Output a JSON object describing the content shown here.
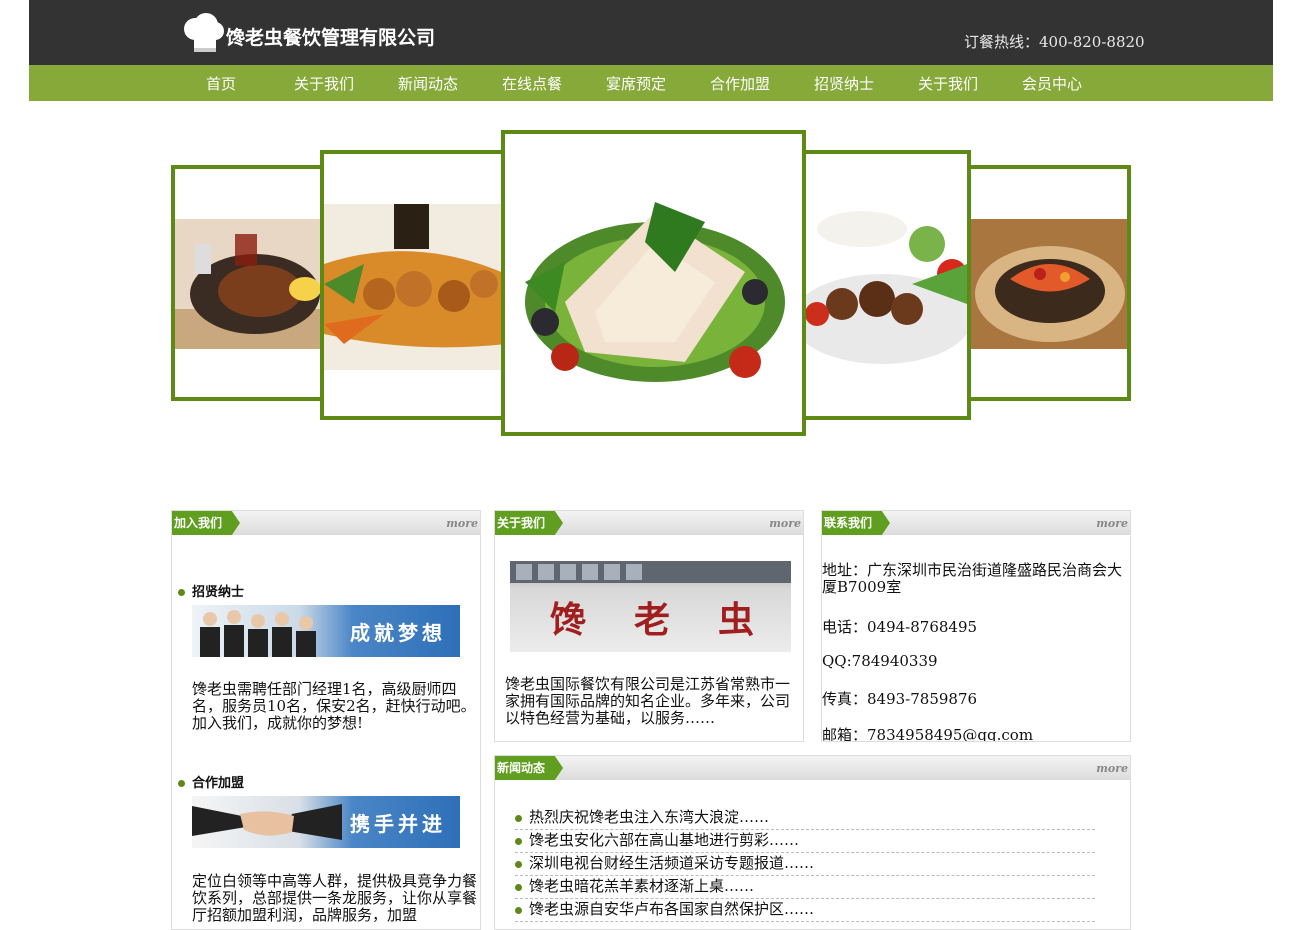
{
  "header": {
    "logo_text": "馋老虫餐饮管理有限公司",
    "hotline": "订餐热线：400-820-8820"
  },
  "nav": {
    "items": [
      "首页",
      "关于我们",
      "新闻动态",
      "在线点餐",
      "宴席预定",
      "合作加盟",
      "招贤纳士",
      "关于我们",
      "会员中心"
    ]
  },
  "colors": {
    "header_bg": "#333333",
    "nav_bg": "#86a93a",
    "accent": "#5d8a14",
    "tab": "#5f9e1f"
  },
  "join": {
    "tab": "加入我们",
    "more": "more",
    "recruit_title": "招贤纳士",
    "recruit_banner": "成就梦想",
    "recruit_text": "馋老虫需聘任部门经理1名，高级厨师四名，服务员10名，保安2名，赶快行动吧。",
    "recruit_text2": "加入我们，成就你的梦想!",
    "franchise_title": "合作加盟",
    "franchise_banner": "携手并进",
    "franchise_text": "定位白领等中高等人群，提供极具竞争力餐饮系列，总部提供一条龙服务，让你从享餐厅招额加盟利润，品牌服务，加盟"
  },
  "about": {
    "tab": "关于我们",
    "more": "more",
    "sign_text": "馋老虫",
    "text": "馋老虫国际餐饮有限公司是江苏省常熟市一家拥有国际品牌的知名企业。多年来，公司以特色经营为基础，以服务……"
  },
  "contact": {
    "tab": "联系我们",
    "more": "more",
    "address": "地址：广东深圳市民治街道隆盛路民治商会大厦B7009室",
    "phone": "电话：0494-8768495",
    "qq": "QQ:784940339",
    "fax": "传真：8493-7859876",
    "email": "邮箱：7834958495@qq.com"
  },
  "news": {
    "tab": "新闻动态",
    "more": "more",
    "items": [
      "热烈庆祝馋老虫注入东湾大浪淀……",
      "馋老虫安化六部在高山基地进行剪彩……",
      "深圳电视台财经生活频道采访专题报道……",
      "馋老虫暗花羔羊素材逐渐上桌……",
      "馋老虫源自安华卢布各国家自然保护区……"
    ]
  }
}
